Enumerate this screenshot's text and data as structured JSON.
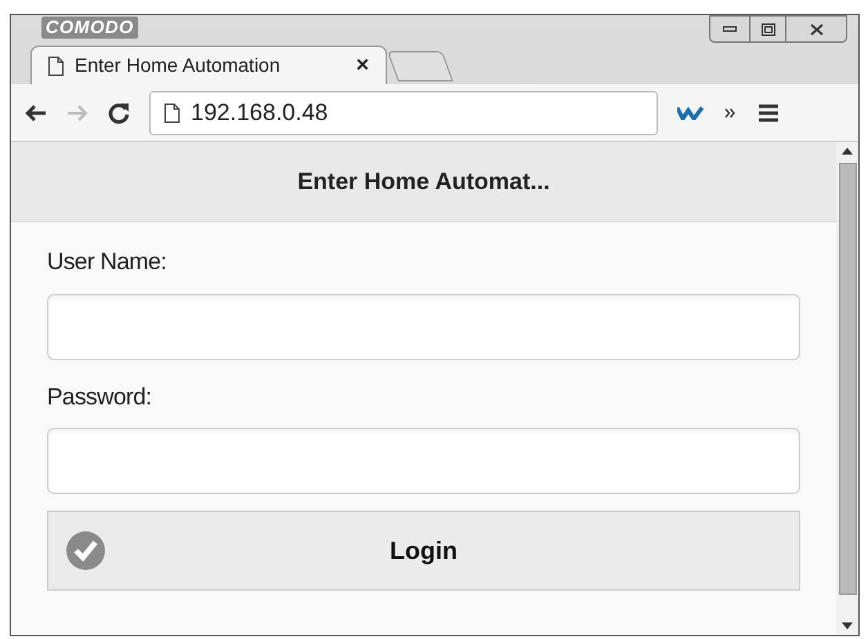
{
  "window": {
    "brand": "COMODO"
  },
  "tabs": [
    {
      "title": "Enter Home Automation",
      "close": "×",
      "selected": true
    }
  ],
  "address_bar": {
    "url": "192.168.0.48"
  },
  "page": {
    "header": "Enter Home Automat...",
    "fields": [
      {
        "label": "User Name:"
      },
      {
        "label": "Password:"
      }
    ],
    "login_button": "Login"
  }
}
